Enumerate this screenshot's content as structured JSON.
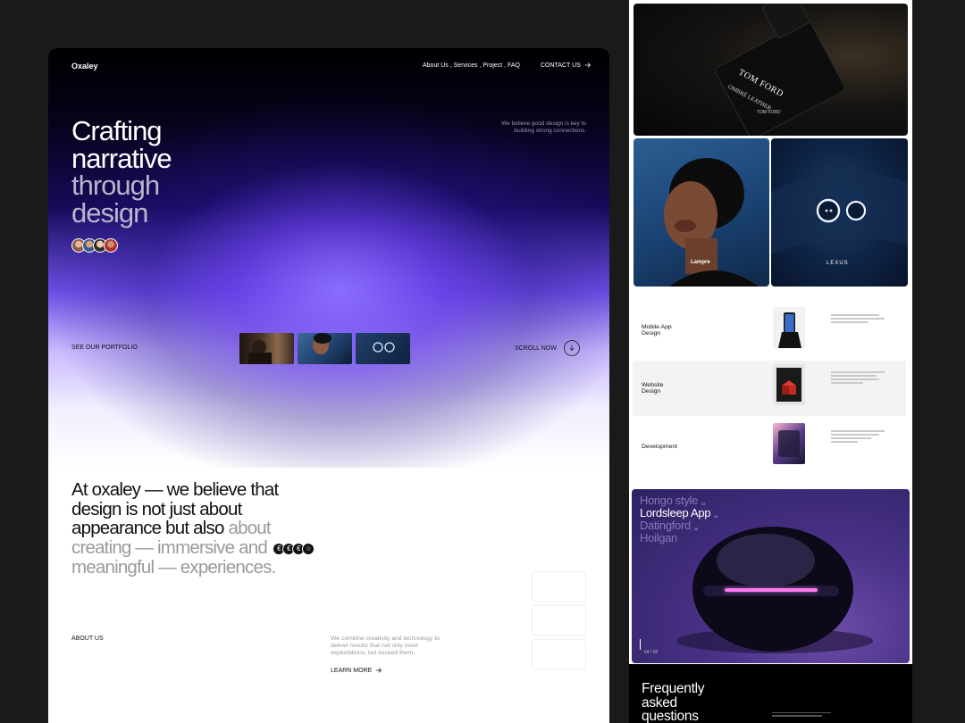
{
  "brand": "Oxaley",
  "nav": {
    "items": [
      "About Us",
      "Services",
      "Project",
      "FAQ"
    ],
    "contact_label": "CONTACT US"
  },
  "hero": {
    "headline_lines": [
      "Crafting",
      "narrative",
      "through",
      "design"
    ],
    "tagline": "We believe good design is key to building strong connections.",
    "see_portfolio": "SEE OUR PORTFOLIO",
    "scroll_now": "SCROLL NOW"
  },
  "about": {
    "statement_dark": "At oxaley — we believe that design is not just about appearance but also",
    "statement_grey_1": "about creating —",
    "statement_grey_2": "immersive and",
    "statement_grey_3": "meaningful — experiences.",
    "label": "ABOUT US",
    "text": "We combine creativity and technology to deliver results that not only meet expectations, but exceed them.",
    "learn_more": "LEARN MORE"
  },
  "gallery": {
    "perfume_brand": "TOM FORD",
    "perfume_name": "OMBRÉ LEATHER",
    "perfume_brand_small": "TOM FORD",
    "portrait_logo": "Lampre",
    "car_logo": "LEXUS"
  },
  "services": [
    {
      "label_line1": "Mobile App",
      "label_line2": "Design"
    },
    {
      "label_line1": "Website",
      "label_line2": "Design"
    },
    {
      "label_line1": "Development",
      "label_line2": ""
    }
  ],
  "promo": {
    "items": [
      {
        "name": "Horigo style",
        "num": "03",
        "active": false
      },
      {
        "name": "Lordsleep App",
        "num": "04",
        "active": true
      },
      {
        "name": "Datingford",
        "num": "05",
        "active": false
      },
      {
        "name": "Hoilgan",
        "num": "",
        "active": false
      }
    ],
    "counter": "04 / 05"
  },
  "faq": {
    "title_line1": "Frequently",
    "title_line2": "asked",
    "title_line3": "questions"
  },
  "colors": {
    "page_bg": "#1a1a1a",
    "accent_purple": "#6e4fe6",
    "promo_purple": "#4a3288"
  }
}
